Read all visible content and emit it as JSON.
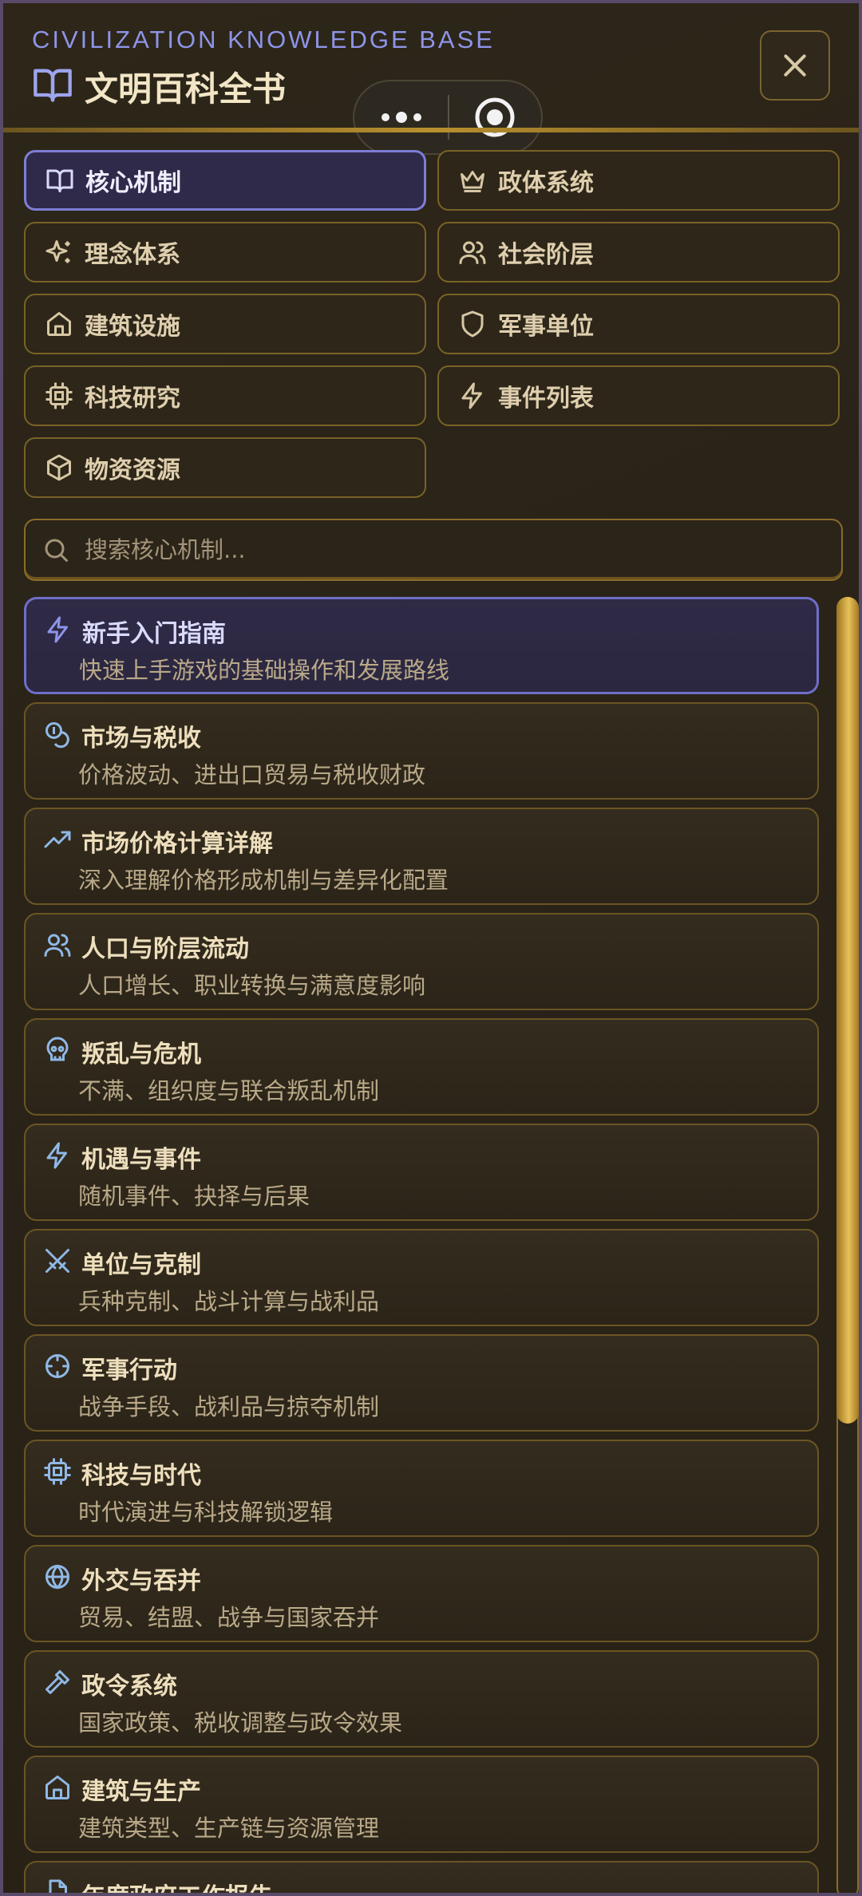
{
  "header": {
    "subtitle": "CIVILIZATION KNOWLEDGE BASE",
    "title": "文明百科全书",
    "title_icon": "book-open-icon",
    "close_icon": "close-icon"
  },
  "mini_capsule": {
    "more_icon": "more-dots-icon",
    "target_icon": "target-icon"
  },
  "categories": [
    {
      "label": "核心机制",
      "icon": "book-open-icon",
      "active": true
    },
    {
      "label": "政体系统",
      "icon": "crown-icon",
      "active": false
    },
    {
      "label": "理念体系",
      "icon": "sparkles-icon",
      "active": false
    },
    {
      "label": "社会阶层",
      "icon": "users-icon",
      "active": false
    },
    {
      "label": "建筑设施",
      "icon": "home-icon",
      "active": false
    },
    {
      "label": "军事单位",
      "icon": "shield-icon",
      "active": false
    },
    {
      "label": "科技研究",
      "icon": "cpu-icon",
      "active": false
    },
    {
      "label": "事件列表",
      "icon": "lightning-icon",
      "active": false
    },
    {
      "label": "物资资源",
      "icon": "box-icon",
      "active": false
    }
  ],
  "search": {
    "placeholder": "搜索核心机制...",
    "value": ""
  },
  "entries": [
    {
      "title": "新手入门指南",
      "desc": "快速上手游戏的基础操作和发展路线",
      "icon": "lightning-icon",
      "active": true
    },
    {
      "title": "市场与税收",
      "desc": "价格波动、进出口贸易与税收财政",
      "icon": "coins-icon",
      "active": false
    },
    {
      "title": "市场价格计算详解",
      "desc": "深入理解价格形成机制与差异化配置",
      "icon": "trending-up-icon",
      "active": false
    },
    {
      "title": "人口与阶层流动",
      "desc": "人口增长、职业转换与满意度影响",
      "icon": "users-icon",
      "active": false
    },
    {
      "title": "叛乱与危机",
      "desc": "不满、组织度与联合叛乱机制",
      "icon": "skull-icon",
      "active": false
    },
    {
      "title": "机遇与事件",
      "desc": "随机事件、抉择与后果",
      "icon": "lightning-icon",
      "active": false
    },
    {
      "title": "单位与克制",
      "desc": "兵种克制、战斗计算与战利品",
      "icon": "crossed-swords-icon",
      "active": false
    },
    {
      "title": "军事行动",
      "desc": "战争手段、战利品与掠夺机制",
      "icon": "crosshair-icon",
      "active": false
    },
    {
      "title": "科技与时代",
      "desc": "时代演进与科技解锁逻辑",
      "icon": "cpu-icon",
      "active": false
    },
    {
      "title": "外交与吞并",
      "desc": "贸易、结盟、战争与国家吞并",
      "icon": "globe-icon",
      "active": false
    },
    {
      "title": "政令系统",
      "desc": "国家政策、税收调整与政令效果",
      "icon": "gavel-icon",
      "active": false
    },
    {
      "title": "建筑与生产",
      "desc": "建筑类型、生产链与资源管理",
      "icon": "home-icon",
      "active": false
    },
    {
      "title": "年度政府工作报告",
      "desc": "",
      "icon": "document-icon",
      "active": false
    }
  ],
  "colors": {
    "accent": "#8e94e8",
    "gold": "#b8902e",
    "background": "#2a2419"
  },
  "scroll": {
    "position_fraction": 0.0,
    "visible_fraction": 0.63
  }
}
